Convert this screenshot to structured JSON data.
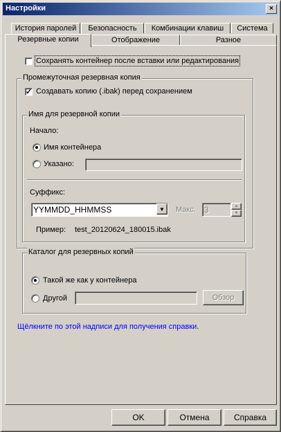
{
  "window": {
    "title": "Настройки",
    "close_glyph": "×"
  },
  "tabs_row1": [
    "История паролей",
    "Безопасность",
    "Комбинации клавиш",
    "Система"
  ],
  "tabs_row2": [
    "Резервные копии",
    "Отображение",
    "Разное"
  ],
  "active_tab": "Резервные копии",
  "keep_container": {
    "label": "Сохранять контейнер после вставки или редактирования",
    "checked": false
  },
  "intermediate_group": {
    "legend": "Промежуточная резервная копия",
    "create_copy": {
      "label": "Создавать копию (.ibak) перед сохранением",
      "checked": true,
      "mark": "✓"
    }
  },
  "name_group": {
    "legend": "Имя для резервной копии",
    "start_label": "Начало:",
    "option_container": "Имя контейнера",
    "option_specified": "Указано:",
    "selected_option": "container",
    "specified_value": "",
    "suffix_label": "Суффикс:",
    "suffix_value": "YYMMDD_HHMMSS",
    "dropdown_glyph": "▼",
    "max_label": "Макс.",
    "max_value": "3",
    "example_label": "Пример:",
    "example_value": "test_20120624_180015.ibak"
  },
  "catalog_group": {
    "legend": "Каталог для резервных копий",
    "option_same": "Такой же как у контейнера",
    "option_other": "Другой",
    "selected_option": "same",
    "other_value": "",
    "browse_label": "Обзор"
  },
  "help_link": "Щёлкните по этой надписи для получения справки.",
  "buttons": {
    "ok": "OK",
    "cancel": "Отмена",
    "help": "Справка"
  },
  "colors": {
    "face": "#d4d0c8",
    "title_start": "#0a246a",
    "title_end": "#a6caf0",
    "link": "#0000ff"
  }
}
